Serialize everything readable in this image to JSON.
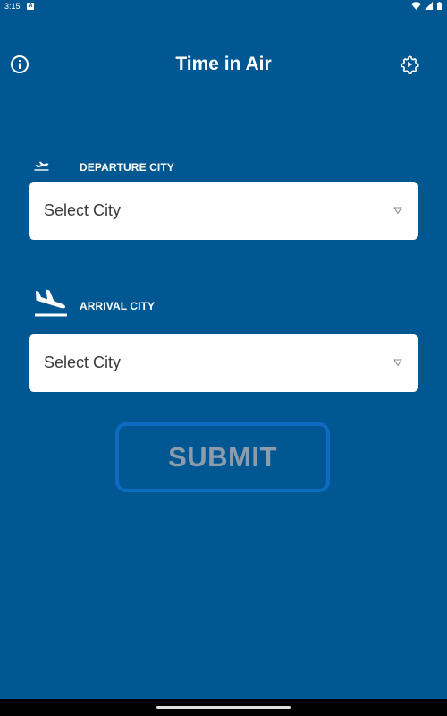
{
  "status_bar": {
    "time": "3:15",
    "notification_icon_letter": "A",
    "icons": [
      "wifi-icon",
      "signal-icon",
      "battery-icon"
    ]
  },
  "header": {
    "title": "Time in Air",
    "left_icon": "info-icon",
    "right_icon": "gear-icon"
  },
  "departure": {
    "icon": "airplane-takeoff-icon",
    "label": "DEPARTURE CITY",
    "select_value": "Select City",
    "dropdown_icon": "chevron-down-icon"
  },
  "arrival": {
    "icon": "airplane-landing-icon",
    "label": "ARRIVAL CITY",
    "select_value": "Select City",
    "dropdown_icon": "chevron-down-icon"
  },
  "submit": {
    "label": "SUBMIT"
  },
  "colors": {
    "background": "#005792",
    "submit_border": "#0d6bc4",
    "submit_text": "#8d9cab",
    "field_background": "#ffffff"
  }
}
